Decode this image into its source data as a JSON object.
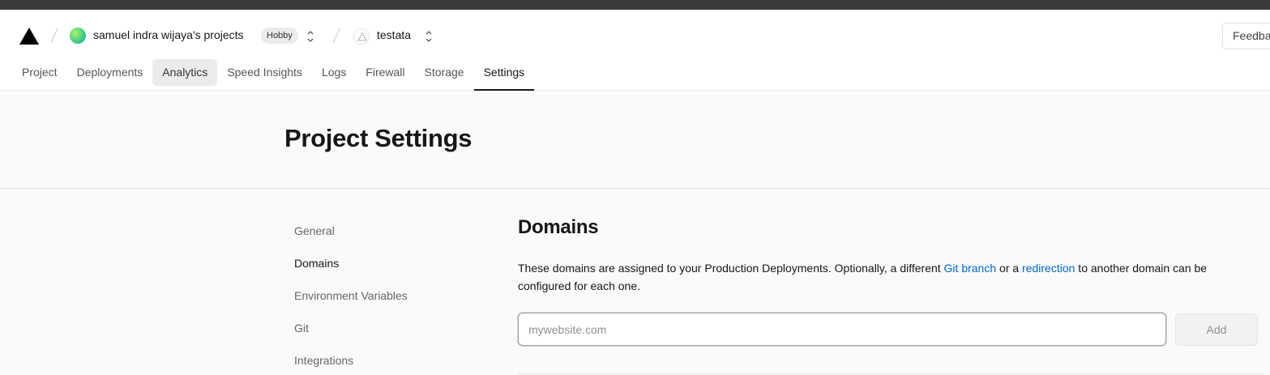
{
  "header": {
    "team": {
      "name": "samuel indra wijaya's projects",
      "plan": "Hobby"
    },
    "project": {
      "name": "testata"
    },
    "feedback_label": "Feedback"
  },
  "tabs": [
    {
      "label": "Project"
    },
    {
      "label": "Deployments"
    },
    {
      "label": "Analytics"
    },
    {
      "label": "Speed Insights"
    },
    {
      "label": "Logs"
    },
    {
      "label": "Firewall"
    },
    {
      "label": "Storage"
    },
    {
      "label": "Settings"
    }
  ],
  "page": {
    "title": "Project Settings"
  },
  "settings_nav": [
    {
      "label": "General"
    },
    {
      "label": "Domains"
    },
    {
      "label": "Environment Variables"
    },
    {
      "label": "Git"
    },
    {
      "label": "Integrations"
    }
  ],
  "domains": {
    "title": "Domains",
    "desc_part1": "These domains are assigned to your Production Deployments. Optionally, a different ",
    "link_git": "Git branch",
    "desc_part2": " or a ",
    "link_redirect": "redirection",
    "desc_part3": " to another domain can be configured for each one.",
    "input_placeholder": "mywebsite.com",
    "input_value": "",
    "add_label": "Add"
  },
  "colors": {
    "link": "#0068d6",
    "active_tab_underline": "#171717"
  }
}
